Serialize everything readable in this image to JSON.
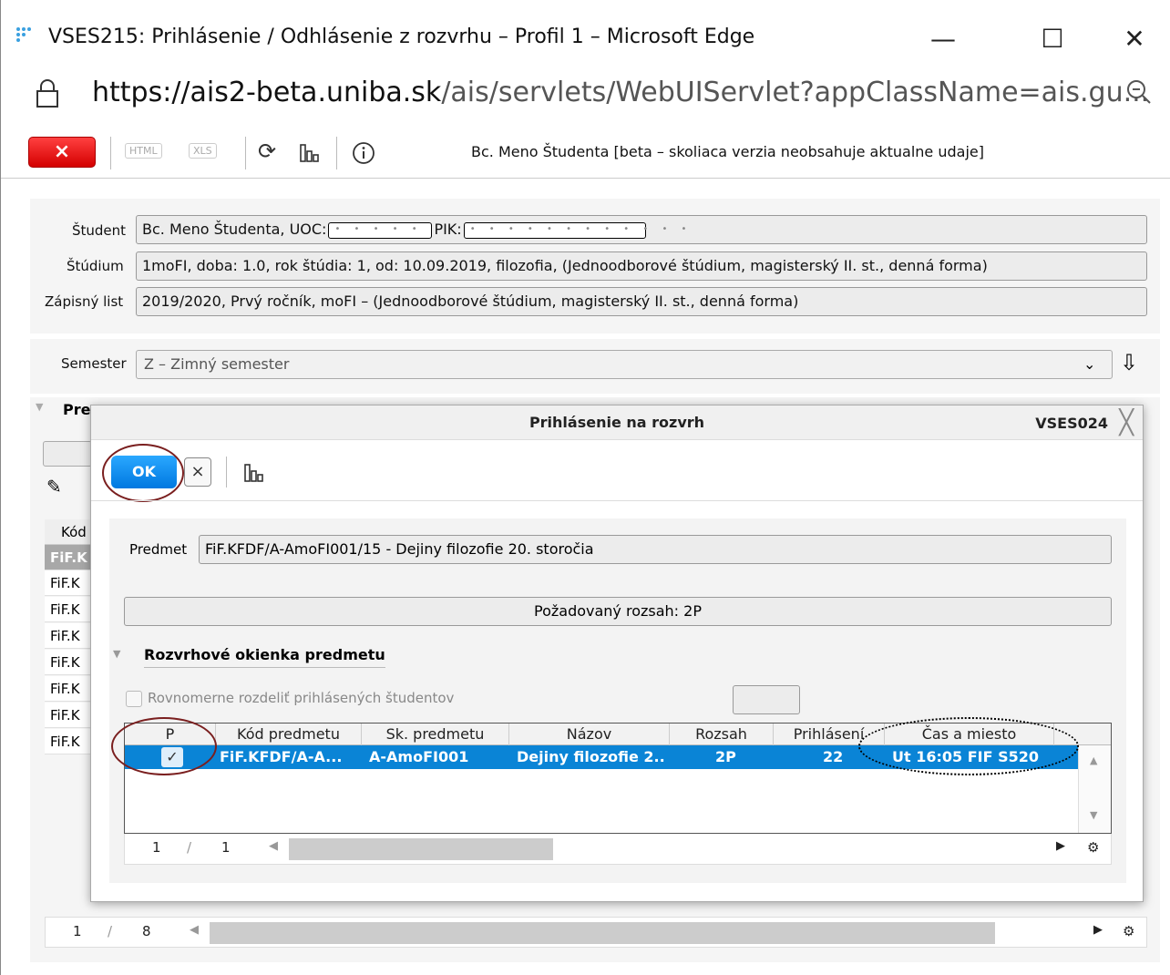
{
  "window": {
    "title": "VSES215: Prihlásenie / Odhlásenie z rozvrhu – Profil 1 – Microsoft Edge",
    "minimize": "—",
    "maximize": "☐",
    "close": "✕"
  },
  "address": {
    "host": "https://ais2-beta.uniba.sk",
    "path": "/ais/servlets/WebUIServlet?appClassName=ais.gu..."
  },
  "toolbar": {
    "close_label": "×",
    "html_label": "HTML",
    "xls_label": "XLS",
    "user_line": "Bc. Meno Študenta [beta – skoliaca verzia neobsahuje aktualne udaje]"
  },
  "student": {
    "student_label": "Študent",
    "student_name": "Bc. Meno Študenta, UOC:",
    "uoc_mask": "• • • • •",
    "pik_label": "PIK:",
    "pik_mask": "• • • • • • • • • • • •",
    "studium_label": "Štúdium",
    "studium_value": "1moFI, doba: 1.0, rok štúdia: 1, od: 10.09.2019, filozofia, (Jednoodborové štúdium, magisterský II. st., denná forma)",
    "zapis_label": "Zápisný list",
    "zapis_value": "2019/2020, Prvý ročník, moFI – (Jednoodborové štúdium, magisterský II. st., denná forma)"
  },
  "semester": {
    "label": "Semester",
    "value": "Z – Zimný semester"
  },
  "background": {
    "section_title": "Pre",
    "kod_header": "Kód",
    "rows": [
      "FiF.K",
      "FiF.K",
      "FiF.K",
      "FiF.K",
      "FiF.K",
      "FiF.K",
      "FiF.K",
      "FiF.K"
    ],
    "pager_current": "1",
    "pager_sep": "/",
    "pager_total": "8"
  },
  "dialog": {
    "title": "Prihlásenie na rozvrh",
    "code": "VSES024",
    "ok_label": "OK",
    "cancel_label": "×",
    "predmet_label": "Predmet",
    "predmet_value": "FiF.KFDF/A-AmoFI001/15 - Dejiny filozofie 20. storočia",
    "rozsah_value": "Požadovaný rozsah: 2P",
    "section_title": "Rozvrhové okienka predmetu",
    "checkbox_label": "Rovnomerne rozdeliť prihlásených študentov",
    "grid": {
      "headers": [
        "P",
        "Kód predmetu",
        "Sk. predmetu",
        "Názov",
        "Rozsah",
        "Prihlásení",
        "Čas a miesto"
      ],
      "row": {
        "checked": "✓",
        "kod": "FiF.KFDF/A-A...",
        "sk": "A-AmoFI001",
        "nazov": "Dejiny filozofie 2...",
        "rozsah": "2P",
        "prihlaseni": "22",
        "cas": "Ut 16:05 FIF S520"
      }
    },
    "pager_current": "1",
    "pager_sep": "/",
    "pager_total": "1"
  }
}
